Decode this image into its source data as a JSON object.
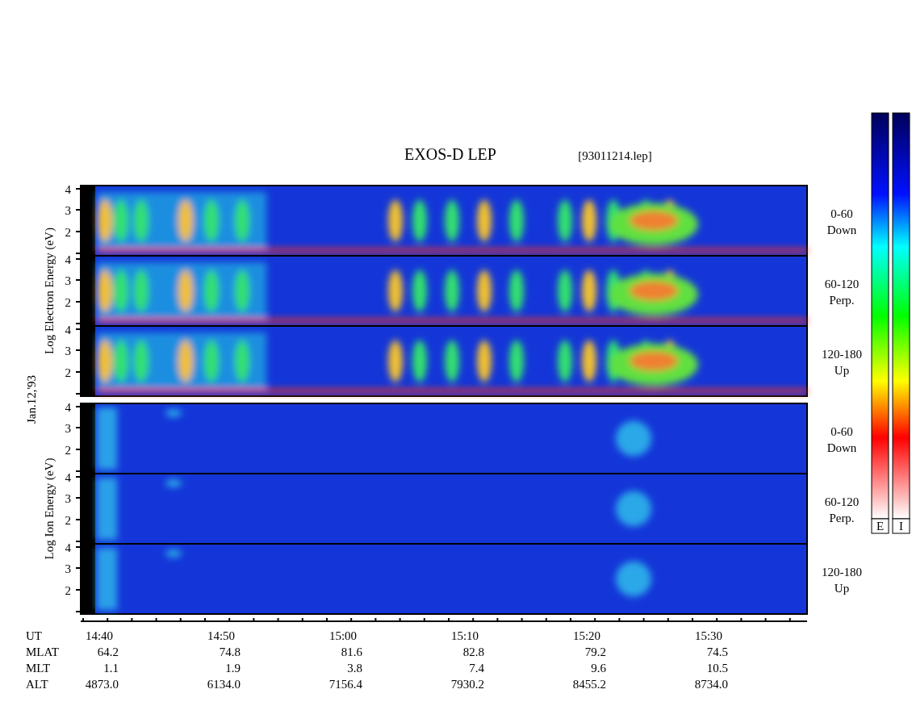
{
  "title": "EXOS-D LEP",
  "file_label": "[93011214.lep]",
  "date_label": "Jan.12,'93",
  "species": [
    {
      "kind": "electron",
      "axis_label": "Log  Electron  Energy (eV)",
      "panels": [
        {
          "angle": "0-60",
          "direction": "Down",
          "yticks": [
            "4",
            "3",
            "2"
          ]
        },
        {
          "angle": "60-120",
          "direction": "Perp.",
          "yticks": [
            "4",
            "3",
            "2"
          ]
        },
        {
          "angle": "120-180",
          "direction": "Up",
          "yticks": [
            "4",
            "3",
            "2"
          ]
        }
      ]
    },
    {
      "kind": "ion",
      "axis_label": "Log  Ion  Energy (eV)",
      "panels": [
        {
          "angle": "0-60",
          "direction": "Down",
          "yticks": [
            "4",
            "3",
            "2"
          ]
        },
        {
          "angle": "60-120",
          "direction": "Perp.",
          "yticks": [
            "4",
            "3",
            "2"
          ]
        },
        {
          "angle": "120-180",
          "direction": "Up",
          "yticks": [
            "4",
            "3",
            "2"
          ]
        }
      ]
    }
  ],
  "colorbars": [
    {
      "label": "E"
    },
    {
      "label": "I"
    }
  ],
  "time_axis": {
    "rows": [
      {
        "label": "UT",
        "values": [
          "14:40",
          "14:50",
          "15:00",
          "15:10",
          "15:20",
          "15:30"
        ]
      },
      {
        "label": "MLAT",
        "values": [
          "64.2",
          "74.8",
          "81.6",
          "82.8",
          "79.2",
          "74.5"
        ]
      },
      {
        "label": "MLT",
        "values": [
          "1.1",
          "1.9",
          "3.8",
          "7.4",
          "9.6",
          "10.5"
        ]
      },
      {
        "label": "ALT",
        "values": [
          "4873.0",
          "6134.0",
          "7156.4",
          "7930.2",
          "8455.2",
          "8734.0"
        ]
      }
    ]
  }
}
